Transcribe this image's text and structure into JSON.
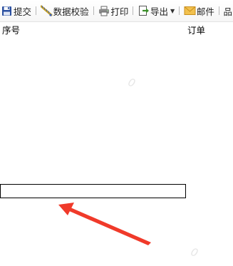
{
  "toolbar": {
    "submit_label": "提交",
    "validate_label": "数据校验",
    "print_label": "打印",
    "export_label": "导出",
    "mail_label": "邮件",
    "more_label": "品"
  },
  "table": {
    "headers": [
      "序号",
      "订单"
    ]
  },
  "watermark": {
    "glyph": "0"
  },
  "colors": {
    "annotation_arrow": "#f03a2a",
    "watermark": "#e6e6e6",
    "save_icon": "#2a4fa0",
    "export_icon": "#3b8f2a",
    "mail_icon": "#e8b23a"
  },
  "icons": [
    "save-icon",
    "ruler-check-icon",
    "printer-icon",
    "export-icon",
    "mail-icon"
  ]
}
